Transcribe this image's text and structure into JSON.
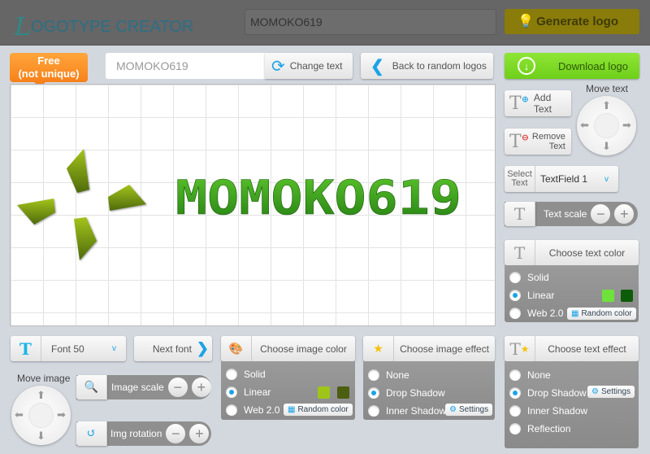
{
  "header": {
    "brand_initial": "L",
    "brand_rest": "OGOTYPE CREATOR",
    "search_value": "MOMOKO619",
    "generate_label": "Generate logo"
  },
  "toolbar": {
    "badge_line1": "Free",
    "badge_line2": "(not unique)",
    "text_value": "MOMOKO619",
    "change_text": "Change text",
    "back_label": "Back to random logos",
    "download_label": "Download logo"
  },
  "canvas": {
    "logo_text": "MOMOKO619",
    "colors": {
      "text_top": "#5dc62c",
      "text_bottom": "#237f12",
      "shape_top": "#a3c41a",
      "shape_bottom": "#4e6a0c"
    }
  },
  "text_tools": {
    "add_text": "Add Text",
    "remove_line1": "Remove",
    "remove_line2": "Text",
    "move_text": "Move text",
    "select_line1": "Select",
    "select_line2": "Text",
    "select_value": "TextField 1",
    "text_scale": "Text scale"
  },
  "text_color": {
    "title": "Choose text color",
    "options": [
      "Solid",
      "Linear",
      "Web 2.0"
    ],
    "selected": "Linear",
    "swatches": [
      "#6ee23a",
      "#0d5c0a"
    ],
    "random": "Random color"
  },
  "font": {
    "value": "Font 50",
    "next": "Next font"
  },
  "image_tools": {
    "move_image": "Move image",
    "image_scale": "Image scale",
    "img_rotation": "Img rotation"
  },
  "image_color": {
    "title": "Choose image color",
    "options": [
      "Solid",
      "Linear",
      "Web 2.0"
    ],
    "selected": "Linear",
    "swatches": [
      "#9ec41a",
      "#4c5e10"
    ],
    "random": "Random color"
  },
  "image_effect": {
    "title": "Choose image effect",
    "options": [
      "None",
      "Drop Shadow",
      "Inner Shadow"
    ],
    "selected": "Drop Shadow",
    "settings": "Settings"
  },
  "text_effect": {
    "title": "Choose text effect",
    "options": [
      "None",
      "Drop Shadow",
      "Inner Shadow",
      "Reflection"
    ],
    "selected": "Drop Shadow",
    "settings": "Settings"
  }
}
